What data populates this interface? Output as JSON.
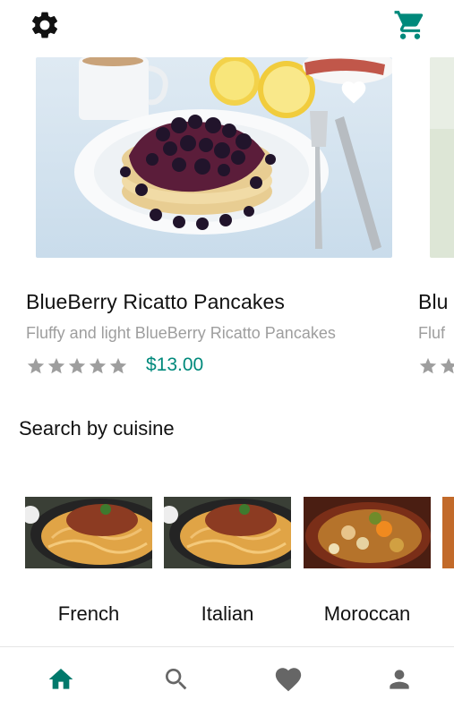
{
  "topbar": {
    "settings_icon": "gear-icon",
    "cart_icon": "shopping-cart-icon",
    "accent_color": "#00897b"
  },
  "featured": [
    {
      "title": "BlueBerry Ricatto Pancakes",
      "subtitle": "Fluffy and light BlueBerry Ricatto Pancakes",
      "rating": 0,
      "rating_max": 5,
      "price": "$13.00",
      "favorite_icon": "heart-icon"
    },
    {
      "title": "Blu",
      "subtitle": "Fluf"
    }
  ],
  "section": {
    "cuisine_title": "Search by cuisine"
  },
  "cuisines": [
    {
      "label": "French"
    },
    {
      "label": "Italian"
    },
    {
      "label": "Moroccan"
    }
  ],
  "bottom_nav": {
    "items": [
      {
        "icon": "home-icon",
        "active": true
      },
      {
        "icon": "search-icon",
        "active": false
      },
      {
        "icon": "heart-icon",
        "active": false
      },
      {
        "icon": "person-icon",
        "active": false
      }
    ],
    "active_color": "#00796b",
    "inactive_color": "#666666"
  }
}
